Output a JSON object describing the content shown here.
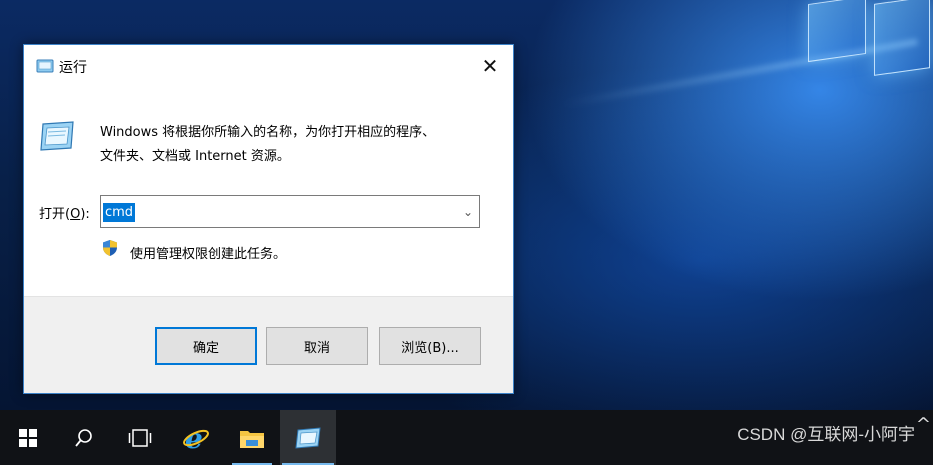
{
  "dialog": {
    "title": "运行",
    "description": "Windows 将根据你所输入的名称，为你打开相应的程序、\n文件夹、文档或 Internet 资源。",
    "open_label_prefix": "打开(",
    "open_label_key": "O",
    "open_label_suffix": "):",
    "input_value": "cmd",
    "admin_note": "使用管理权限创建此任务。",
    "buttons": {
      "ok": "确定",
      "cancel": "取消",
      "browse": "浏览(B)..."
    }
  },
  "taskbar": {
    "items": [
      {
        "icon": "windows-start-icon"
      },
      {
        "icon": "search-icon"
      },
      {
        "icon": "task-view-icon"
      },
      {
        "icon": "internet-explorer-icon"
      },
      {
        "icon": "file-explorer-icon"
      },
      {
        "icon": "run-dialog-icon"
      }
    ]
  },
  "watermark": "CSDN @互联网-小阿宇",
  "tray_chevron": "^",
  "colors": {
    "accent": "#0078d7",
    "taskbar": "#101216",
    "dialog_footer": "#f0f0f0"
  }
}
